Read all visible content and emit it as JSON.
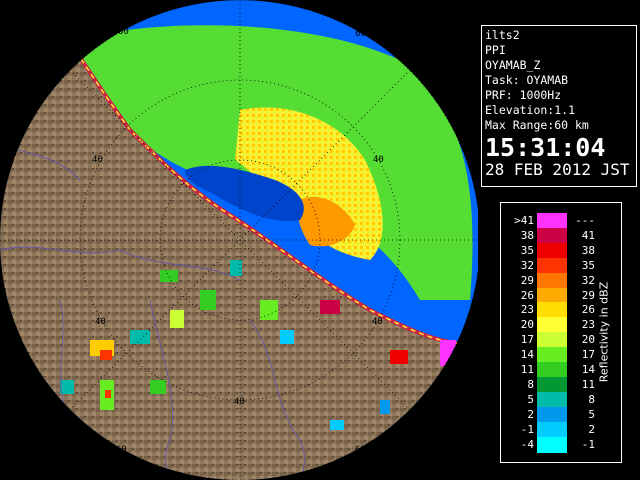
{
  "info_panel": {
    "radar_name": "ilts2",
    "scan_type": "PPI",
    "product": "OYAMAB_Z",
    "task": "Task: OYAMAB",
    "prf": "PRF: 1000Hz",
    "elevation": "Elevation:1.1",
    "max_range": "Max Range:60 km",
    "time": "15:31:04",
    "date": "28 FEB 2012 JST"
  },
  "legend": {
    "title": "Reflectivity in dBZ",
    "rows": [
      {
        "lo": ">41",
        "hi": "---",
        "color": "#ff33ff"
      },
      {
        "lo": "38",
        "hi": "41",
        "color": "#cc0044"
      },
      {
        "lo": "35",
        "hi": "38",
        "color": "#ee0000"
      },
      {
        "lo": "32",
        "hi": "35",
        "color": "#ff3300"
      },
      {
        "lo": "29",
        "hi": "32",
        "color": "#ff7700"
      },
      {
        "lo": "26",
        "hi": "29",
        "color": "#ffaa00"
      },
      {
        "lo": "23",
        "hi": "26",
        "color": "#ffdd00"
      },
      {
        "lo": "20",
        "hi": "23",
        "color": "#ffff33"
      },
      {
        "lo": "17",
        "hi": "20",
        "color": "#ccff33"
      },
      {
        "lo": "14",
        "hi": "17",
        "color": "#66ee22"
      },
      {
        "lo": "11",
        "hi": "14",
        "color": "#33cc22"
      },
      {
        "lo": "8",
        "hi": "11",
        "color": "#009933"
      },
      {
        "lo": "5",
        "hi": "8",
        "color": "#00bbaa"
      },
      {
        "lo": "2",
        "hi": "5",
        "color": "#0099ee"
      },
      {
        "lo": "-1",
        "hi": "2",
        "color": "#00ccff"
      },
      {
        "lo": "-4",
        "hi": "-1",
        "color": "#00ffff"
      }
    ]
  },
  "range_rings": {
    "labels": [
      "60",
      "60",
      "40",
      "40",
      "40",
      "40",
      "60",
      "60"
    ]
  },
  "colors": {
    "land": "#8c7459",
    "sea_echo": "#0066ff",
    "background": "#000000"
  }
}
